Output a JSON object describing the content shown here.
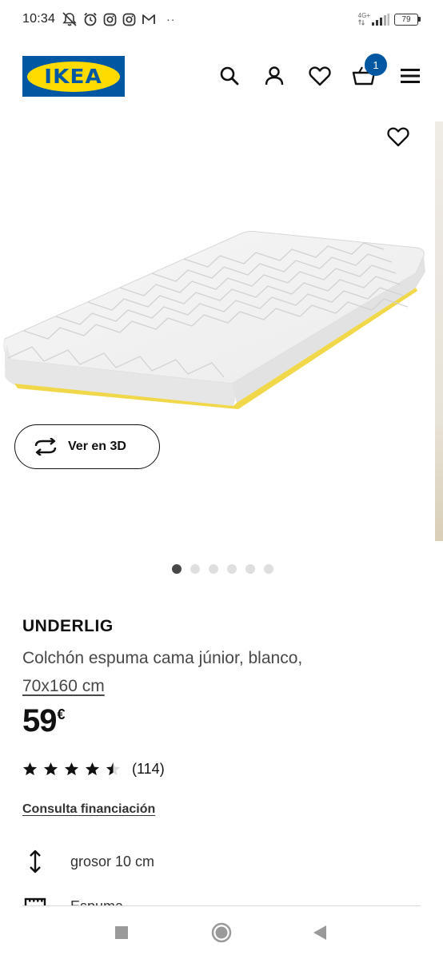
{
  "status_bar": {
    "time": "10:34",
    "network": "4G+",
    "battery": "79",
    "more": "··"
  },
  "header": {
    "logo_text": "IKEA",
    "cart_count": "1",
    "icons": [
      "search-icon",
      "account-icon",
      "wishlist-icon",
      "cart-icon",
      "menu-icon"
    ]
  },
  "gallery": {
    "view_3d_label": "Ver en 3D",
    "image_count": 6,
    "active_index": 0
  },
  "product": {
    "name": "UNDERLIG",
    "description": "Colchón espuma cama júnior, blanco,",
    "size": "70x160 cm",
    "price_integer": "59",
    "currency": "€",
    "rating": 4.5,
    "review_count": "(114)",
    "financing_link": "Consulta financiación",
    "specs": [
      {
        "icon": "thickness-icon",
        "label": "grosor 10 cm"
      },
      {
        "icon": "foam-icon",
        "label": "Espuma"
      }
    ]
  },
  "colors": {
    "brand_blue": "#0058a3",
    "brand_yellow": "#ffdb00",
    "text_primary": "#111111",
    "text_secondary": "#484848"
  }
}
